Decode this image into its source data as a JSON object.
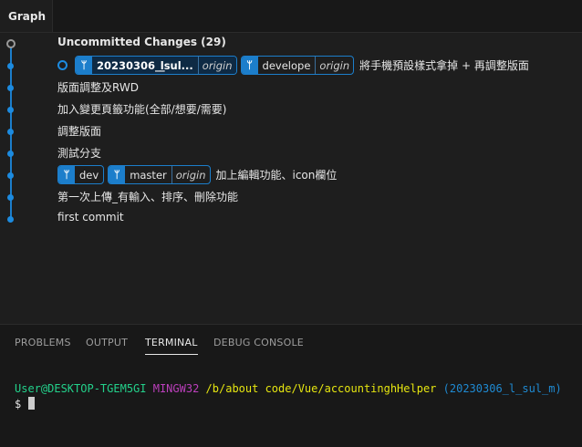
{
  "tabbar": {
    "title": "Graph"
  },
  "graph": {
    "uncommitted_label": "Uncommitted Changes (29)",
    "head_commit": {
      "refs": [
        {
          "name": "20230306_l̲sul...",
          "remote": "origin"
        },
        {
          "name": "develope",
          "remote": "origin"
        }
      ],
      "message": "將手機預設樣式拿掉 + 再調整版面"
    },
    "commits": [
      "版面調整及RWD",
      "加入變更頁籤功能(全部/想要/需要)",
      "調整版面",
      "測試分支"
    ],
    "dev_commit": {
      "refs": [
        {
          "name": "dev",
          "remote": ""
        },
        {
          "name": "master",
          "remote": "origin"
        }
      ],
      "message": "加上編輯功能、icon欄位"
    },
    "commits_after": [
      "第一次上傳_有輸入、排序、刪除功能",
      "first commit"
    ]
  },
  "panel": {
    "tabs": [
      "PROBLEMS",
      "OUTPUT",
      "TERMINAL",
      "DEBUG CONSOLE"
    ],
    "active_tab": "TERMINAL"
  },
  "terminal": {
    "user": "User@DESKTOP-TGEM5GI",
    "system": "MINGW32",
    "path": "/b/about code/Vue/accountinghHelper",
    "branch": "(20230306_l̲sul̲m)",
    "prompt": "$"
  },
  "icons": {
    "branch": "git-branch-icon",
    "commit": "commit-dot-icon"
  },
  "colors": {
    "accent": "#1c7ecb",
    "user": "#23d18b",
    "system": "#bc3fbc",
    "path": "#e5e510",
    "branch": "#1f8ad2"
  }
}
